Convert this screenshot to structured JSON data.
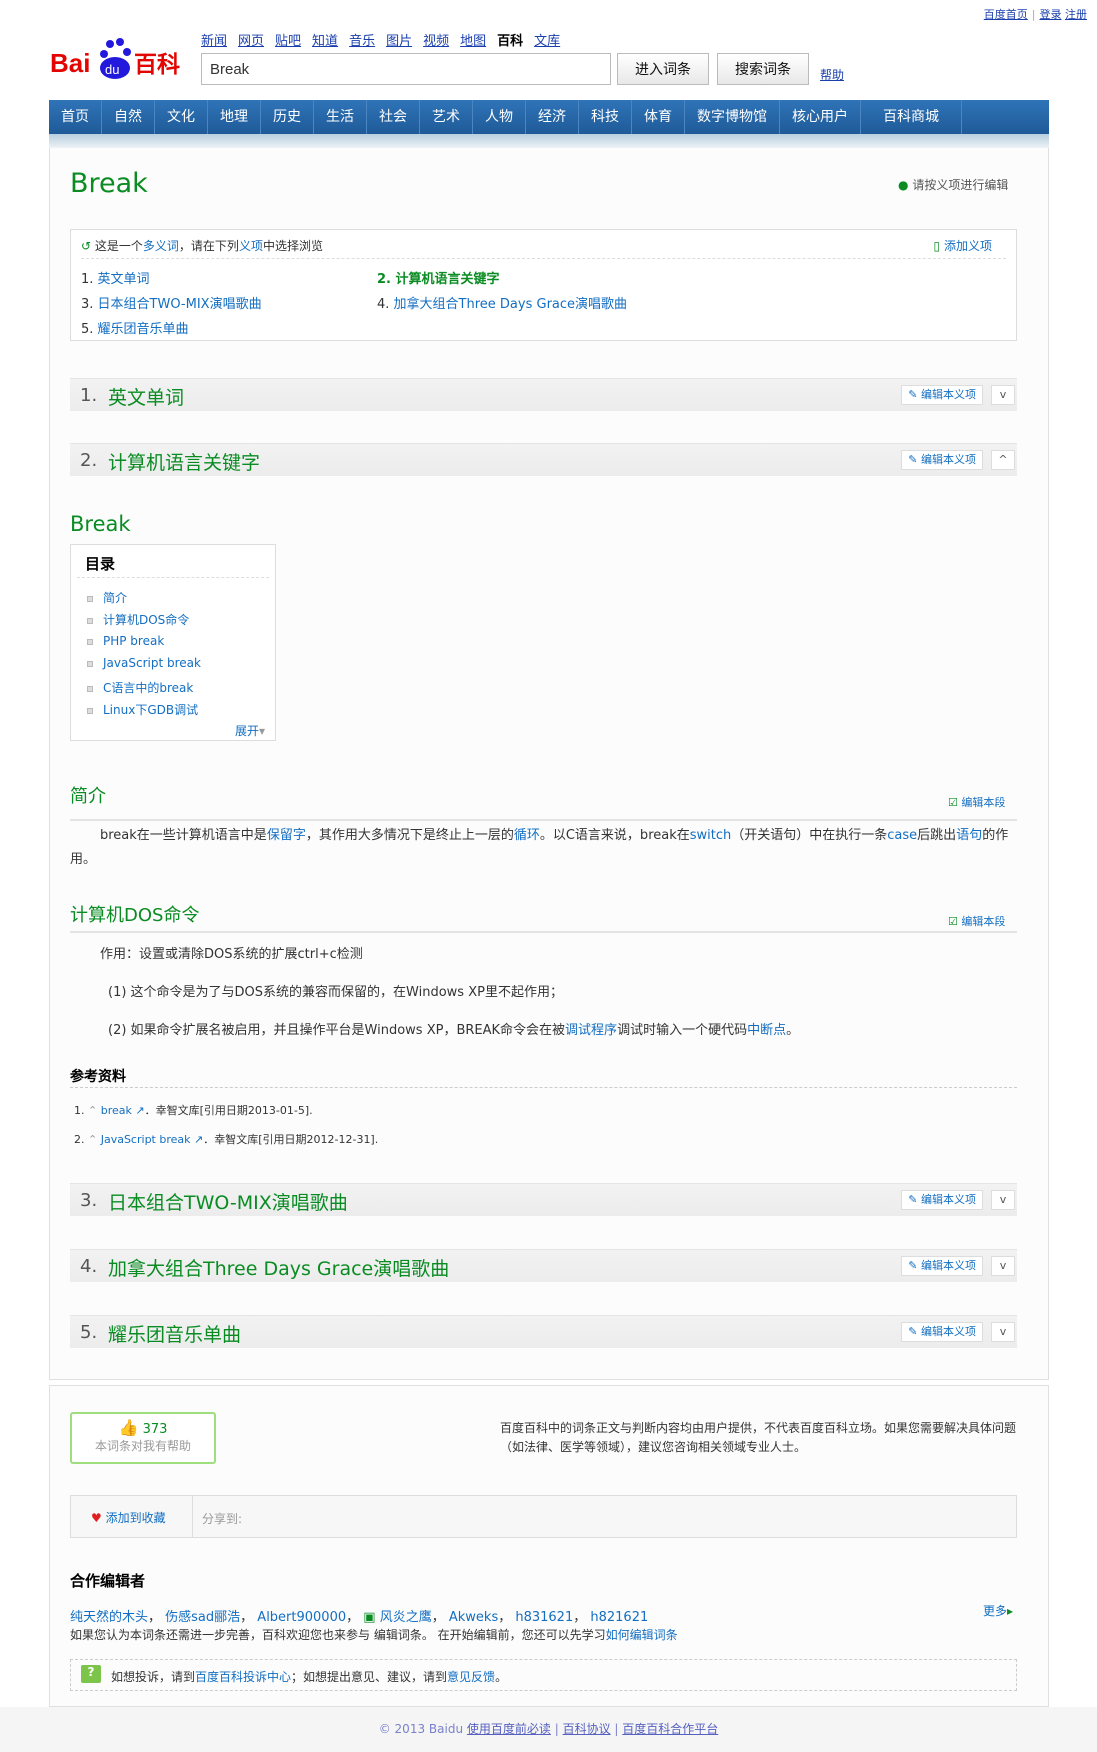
{
  "top_links": [
    "百度首页",
    "登录",
    "注册"
  ],
  "logo": "Baidu百科",
  "product_nav": [
    {
      "label": "新闻"
    },
    {
      "label": "网页"
    },
    {
      "label": "贴吧"
    },
    {
      "label": "知道"
    },
    {
      "label": "音乐"
    },
    {
      "label": "图片"
    },
    {
      "label": "视频"
    },
    {
      "label": "地图"
    },
    {
      "label": "百科",
      "current": true
    },
    {
      "label": "文库"
    }
  ],
  "search": {
    "value": "Break",
    "enter_label": "进入词条",
    "search_label": "搜索词条",
    "help": "帮助"
  },
  "nav": [
    "首页",
    "自然",
    "文化",
    "地理",
    "历史",
    "生活",
    "社会",
    "艺术",
    "人物",
    "经济",
    "科技",
    "体育",
    "数字博物馆",
    "核心用户",
    "百科商城"
  ],
  "title": "Break",
  "edit_tip": "请按义项进行编辑",
  "disambig": {
    "prefix": "这是一个",
    "polysemy": "多义词",
    "mid": "，请在下列",
    "item": "义项",
    "suffix": "中选择浏览",
    "add": "添加义项",
    "options": [
      {
        "num": "1.",
        "label": "英文单词"
      },
      {
        "num": "2.",
        "label": "计算机语言关键字"
      },
      {
        "num": "3.",
        "label": "日本组合TWO-MIX演唱歌曲"
      },
      {
        "num": "4.",
        "label": "加拿大组合Three Days Grace演唱歌曲"
      },
      {
        "num": "5.",
        "label": "耀乐团音乐单曲"
      }
    ]
  },
  "sections": [
    {
      "num": "1.",
      "name": "英文单词",
      "toggle": "v"
    },
    {
      "num": "2.",
      "name": "计算机语言关键字",
      "toggle": "^"
    },
    {
      "num": "3.",
      "name": "日本组合TWO-MIX演唱歌曲",
      "toggle": "v"
    },
    {
      "num": "4.",
      "name": "加拿大组合Three Days Grace演唱歌曲",
      "toggle": "v"
    },
    {
      "num": "5.",
      "name": "耀乐团音乐单曲",
      "toggle": "v"
    }
  ],
  "edit_sense": "编辑本义项",
  "subtitle": "Break",
  "toc": {
    "title": "目录",
    "items": [
      "简介",
      "计算机DOS命令",
      "PHP break",
      "JavaScript break",
      "C语言中的break",
      "Linux下GDB调试"
    ],
    "expand": "展开"
  },
  "edit_para": "编辑本段",
  "intro": {
    "heading": "简介",
    "t1": "break在一些计算机语言中是",
    "l1": "保留字",
    "t2": "，其作用大多情况下是终止上一层的",
    "l2": "循环",
    "t3": "。以C语言来说，break在",
    "l3": "switch",
    "t4": "（开关语句）中在执行一条",
    "l4": "case",
    "t5": "后跳出",
    "l5": "语句",
    "t6": "的作用。"
  },
  "dos": {
    "heading": "计算机DOS命令",
    "line1": "作用：设置或清除DOS系统的扩展ctrl+c检测",
    "line2": "(1) 这个命令是为了与DOS系统的兼容而保留的，在Windows XP里不起作用；",
    "l3a": "(2) 如果命令扩展名被启用，并且操作平台是Windows XP，BREAK命令会在被",
    "l3link": "调试程序",
    "l3b": "调试时输入一个硬代码",
    "l3link2": "中断点",
    "l3c": "。"
  },
  "refs": {
    "heading": "参考资料",
    "items": [
      {
        "num": "1.",
        "link": "break",
        "text": "．幸智文库[引用日期2013-01-5]."
      },
      {
        "num": "2.",
        "link": "JavaScript break",
        "text": "．幸智文库[引用日期2012-12-31]."
      }
    ]
  },
  "like": {
    "count": "373",
    "label": "本词条对我有帮助"
  },
  "disclaimer": "百度百科中的词条正文与判断内容均由用户提供，不代表百度百科立场。如果您需要解决具体问题（如法律、医学等领域），建议您咨询相关领域专业人士。",
  "share": {
    "favorite": "添加到收藏",
    "share_to": "分享到:"
  },
  "collab": {
    "heading": "合作编辑者",
    "editors": [
      "纯天然的木头",
      "伤感sad郦浩",
      "Albert900000",
      "风炎之鹰",
      "Akweks",
      "h831621",
      "h821621"
    ],
    "more": "更多",
    "invite": "如果您认为本词条还需进一步完善，百科欢迎您也来参与 编辑词条。 在开始编辑前，您还可以先学习",
    "invite_link": "如何编辑词条"
  },
  "notice": {
    "t1": "如想投诉，请到",
    "l1": "百度百科投诉中心",
    "t2": "；如想提出意见、建议，请到",
    "l2": "意见反馈",
    "t3": "。"
  },
  "footer": {
    "copy": "© 2013 Baidu",
    "links": [
      "使用百度前必读",
      "百科协议",
      "百度百科合作平台"
    ]
  }
}
